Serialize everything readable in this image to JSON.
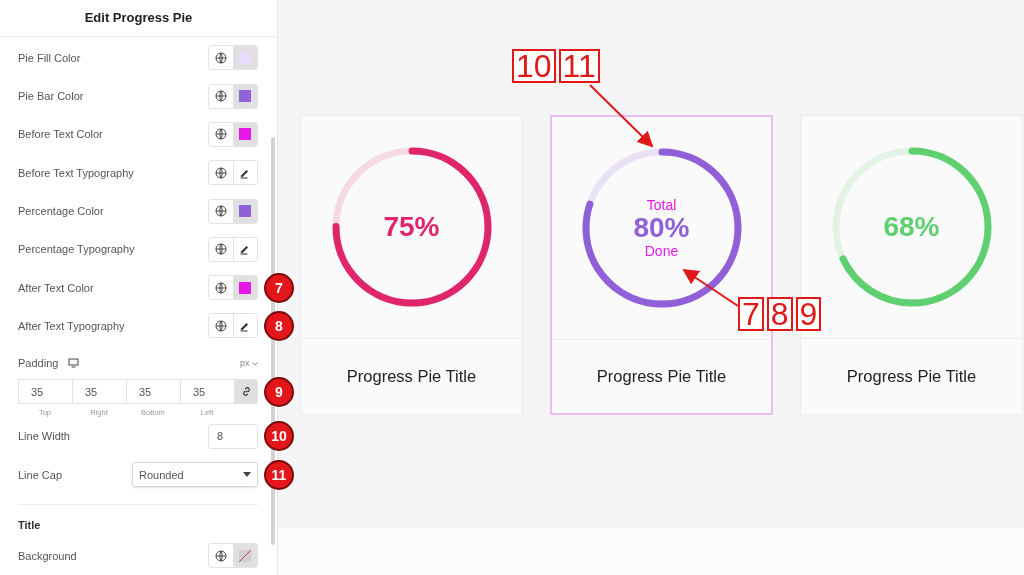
{
  "panel": {
    "title": "Edit Progress Pie",
    "rows": [
      {
        "kind": "color",
        "label": "Pie Fill Color",
        "color": "#e8dcfb"
      },
      {
        "kind": "color",
        "label": "Pie Bar Color",
        "color": "#9060d8"
      },
      {
        "kind": "color",
        "label": "Before Text Color",
        "color": "#e619e6"
      },
      {
        "kind": "typography",
        "label": "Before Text Typography"
      },
      {
        "kind": "color",
        "label": "Percentage Color",
        "color": "#9060d8"
      },
      {
        "kind": "typography",
        "label": "Percentage Typography"
      },
      {
        "kind": "color",
        "label": "After Text Color",
        "color": "#e619e6",
        "badge": "7"
      },
      {
        "kind": "typography",
        "label": "After Text Typography",
        "badge": "8"
      }
    ],
    "padding": {
      "label": "Padding",
      "unit": "px",
      "values": [
        {
          "value": "35",
          "label": "Top"
        },
        {
          "value": "35",
          "label": "Right"
        },
        {
          "value": "35",
          "label": "Bottom"
        },
        {
          "value": "35",
          "label": "Left"
        }
      ],
      "badge": "9"
    },
    "line_width": {
      "label": "Line Width",
      "value": "8",
      "badge": "10"
    },
    "line_cap": {
      "label": "Line Cap",
      "value": "Rounded",
      "badge": "11"
    },
    "section": "Title",
    "background": {
      "label": "Background",
      "kind": "none"
    }
  },
  "pies": [
    {
      "percent": "75%",
      "color": "#e0266a",
      "title": "Progress Pie Title",
      "selected": false
    },
    {
      "before": "Total",
      "percent": "80%",
      "after": "Done",
      "color": "#9060d8",
      "title": "Progress Pie Title",
      "selected": true
    },
    {
      "percent": "68%",
      "color": "#5fcf6f",
      "title": "Progress Pie Title",
      "selected": false
    }
  ],
  "annotations": [
    {
      "labels": [
        "10",
        "11"
      ]
    },
    {
      "labels": [
        "7",
        "8",
        "9"
      ]
    }
  ]
}
